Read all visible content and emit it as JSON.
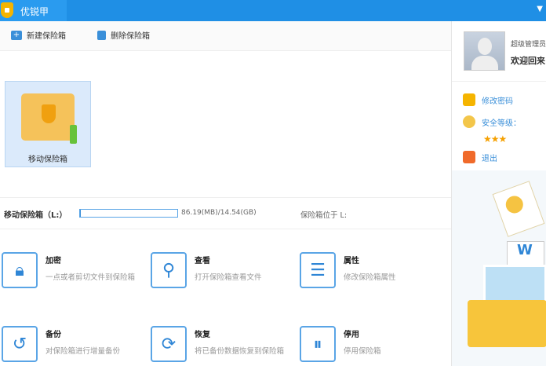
{
  "app": {
    "title": "优锐甲"
  },
  "toolbar": {
    "new": "新建保险箱",
    "delete": "删除保险箱"
  },
  "vault": {
    "label": "移动保险箱"
  },
  "status": {
    "drive_label": "移动保险箱（L:）",
    "progress_percent": 0.6,
    "usage": "86.19(MB)/14.54(GB)",
    "location": "保险箱位于 L:"
  },
  "functions": [
    {
      "name": "加密",
      "desc": "一点或者剪切文件到保险箱",
      "icon": "lock-icon"
    },
    {
      "name": "查看",
      "desc": "打开保险箱查看文件",
      "icon": "search-icon"
    },
    {
      "name": "属性",
      "desc": "修改保险箱属性",
      "icon": "list-icon"
    },
    {
      "name": "备份",
      "desc": "对保险箱进行增量备份",
      "icon": "history-icon"
    },
    {
      "name": "恢复",
      "desc": "将已备份数据恢复到保险箱",
      "icon": "refresh-icon"
    },
    {
      "name": "停用",
      "desc": "停用保险箱",
      "icon": "pause-icon"
    }
  ],
  "user": {
    "name": "超级管理员",
    "welcome": "欢迎回来",
    "change_password": "修改密码",
    "security_level": "安全等级：",
    "stars": 3,
    "logout": "退出"
  },
  "colors": {
    "accent": "#1f8fe5",
    "icon": "#2f86d6"
  }
}
